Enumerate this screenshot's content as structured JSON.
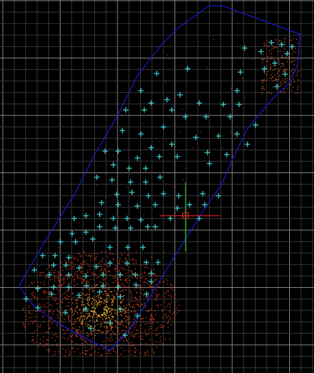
{
  "viewport": {
    "background": "#000000",
    "grid": {
      "visible": true,
      "minor_color": "#3a3a3a",
      "major_color": "#8a8a8a"
    }
  },
  "boundary": {
    "color": "#1a1acc"
  },
  "survey_points": {
    "marker": "plus-marker",
    "color": "#40e0e0"
  },
  "point_cloud": {
    "color_low": "#d23a1e",
    "color_high": "#ffd23a",
    "core_color": "#000000"
  },
  "ucs_cursor": {
    "x_axis_color": "#e02020",
    "y_axis_color": "#20c020",
    "pick_box_color": "#e02020"
  }
}
